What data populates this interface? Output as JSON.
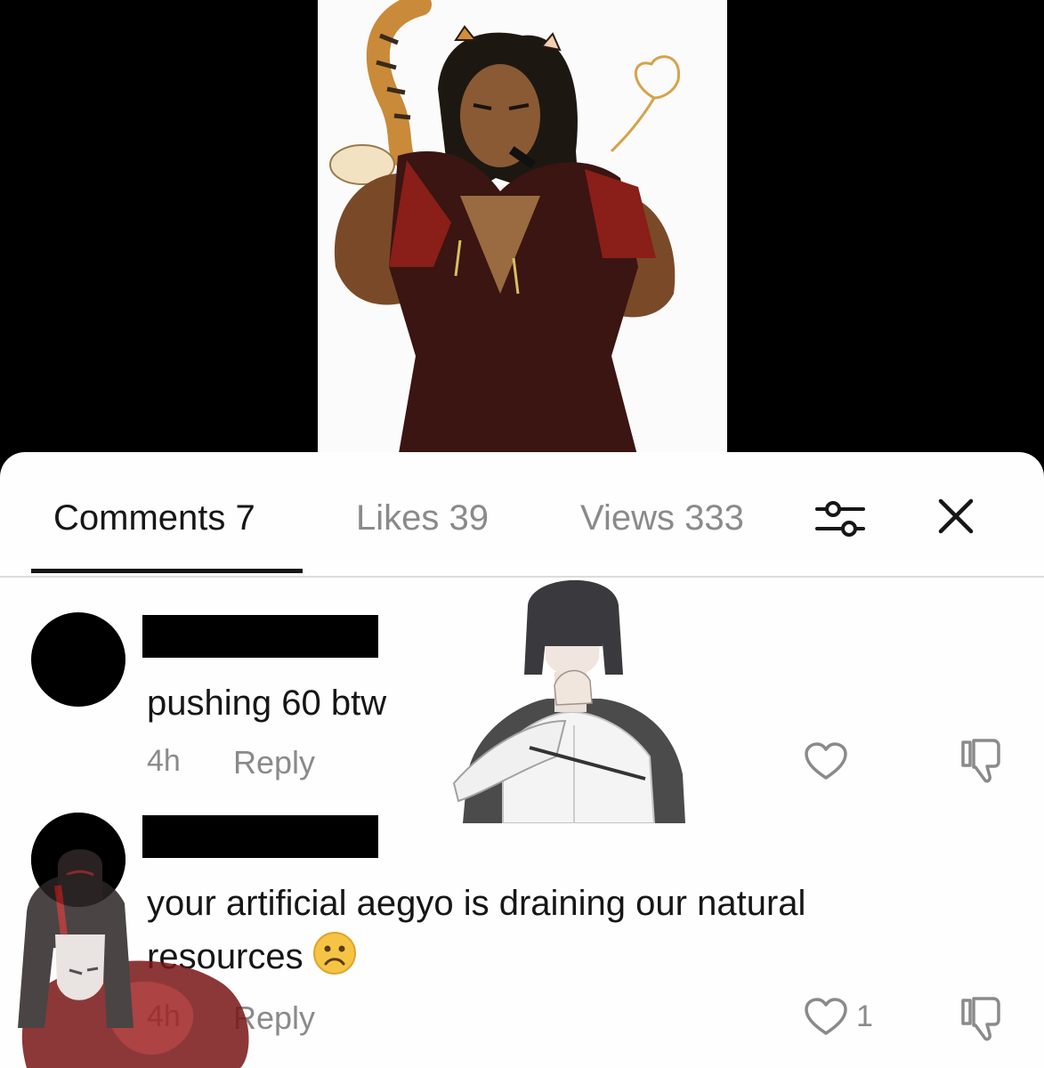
{
  "tabs": {
    "comments": "Comments 7",
    "likes": "Likes 39",
    "views": "Views 333"
  },
  "icons": {
    "filter": "filter-sliders-icon",
    "close": "close-icon",
    "like": "heart-outline-icon",
    "dislike": "thumbs-down-icon",
    "emoji": "frowning-face-emoji"
  },
  "comments": [
    {
      "text": "pushing 60  btw",
      "time": "4h",
      "reply_label": "Reply",
      "like_count": ""
    },
    {
      "text": "your artificial aegyo is draining our natural resources",
      "emoji": "🙁",
      "time": "4h",
      "reply_label": "Reply",
      "like_count": "1"
    }
  ],
  "colors": {
    "active_tab": "#161616",
    "inactive_text": "#8a8a8a",
    "sheet_background": "#fefefe",
    "backdrop": "#000000"
  }
}
